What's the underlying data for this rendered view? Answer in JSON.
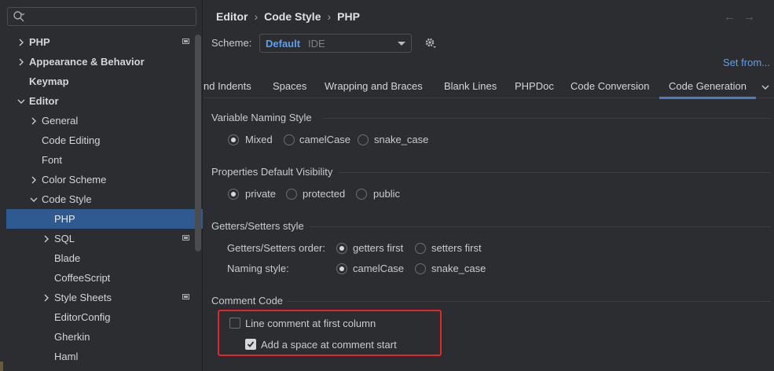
{
  "sidebar": {
    "search_placeholder": "",
    "items": [
      {
        "label": "PHP",
        "bold": true,
        "chevron": "right",
        "project_icon": true
      },
      {
        "label": "Appearance & Behavior",
        "bold": true,
        "chevron": "right"
      },
      {
        "label": "Keymap",
        "bold": true
      },
      {
        "label": "Editor",
        "bold": true,
        "chevron": "down"
      },
      {
        "label": "General",
        "chevron": "right"
      },
      {
        "label": "Code Editing"
      },
      {
        "label": "Font"
      },
      {
        "label": "Color Scheme",
        "chevron": "right"
      },
      {
        "label": "Code Style",
        "chevron": "down"
      },
      {
        "label": "PHP",
        "selected": true
      },
      {
        "label": "SQL",
        "chevron": "right",
        "project_icon": true
      },
      {
        "label": "Blade"
      },
      {
        "label": "CoffeeScript"
      },
      {
        "label": "Style Sheets",
        "chevron": "right",
        "project_icon": true
      },
      {
        "label": "EditorConfig"
      },
      {
        "label": "Gherkin"
      },
      {
        "label": "Haml"
      }
    ]
  },
  "breadcrumb": [
    "Editor",
    "Code Style",
    "PHP"
  ],
  "nav": {
    "back": "←",
    "forward": "→"
  },
  "scheme": {
    "label": "Scheme:",
    "value": "Default",
    "sub": "IDE"
  },
  "set_from": "Set from...",
  "tabs": [
    "nd Indents",
    "Spaces",
    "Wrapping and Braces",
    "Blank Lines",
    "PHPDoc",
    "Code Conversion",
    "Code Generation"
  ],
  "active_tab": "Code Generation",
  "sections": {
    "naming": {
      "title": "Variable Naming Style",
      "options": [
        "Mixed",
        "camelCase",
        "snake_case"
      ],
      "selected": "Mixed"
    },
    "visibility": {
      "title": "Properties Default Visibility",
      "options": [
        "private",
        "protected",
        "public"
      ],
      "selected": "private"
    },
    "getters": {
      "title": "Getters/Setters style",
      "order_label": "Getters/Setters order:",
      "order_options": [
        "getters first",
        "setters first"
      ],
      "order_selected": "getters first",
      "naming_label": "Naming style:",
      "naming_options": [
        "camelCase",
        "snake_case"
      ],
      "naming_selected": "camelCase"
    },
    "comment": {
      "title": "Comment Code",
      "line_comment_label": "Line comment at first column",
      "line_comment_checked": false,
      "add_space_label": "Add a space at comment start",
      "add_space_checked": true
    }
  },
  "colors": {
    "accent": "#4b79c2",
    "link": "#5a9ff5",
    "selection": "#2f5a91",
    "highlight": "#e0272a"
  }
}
